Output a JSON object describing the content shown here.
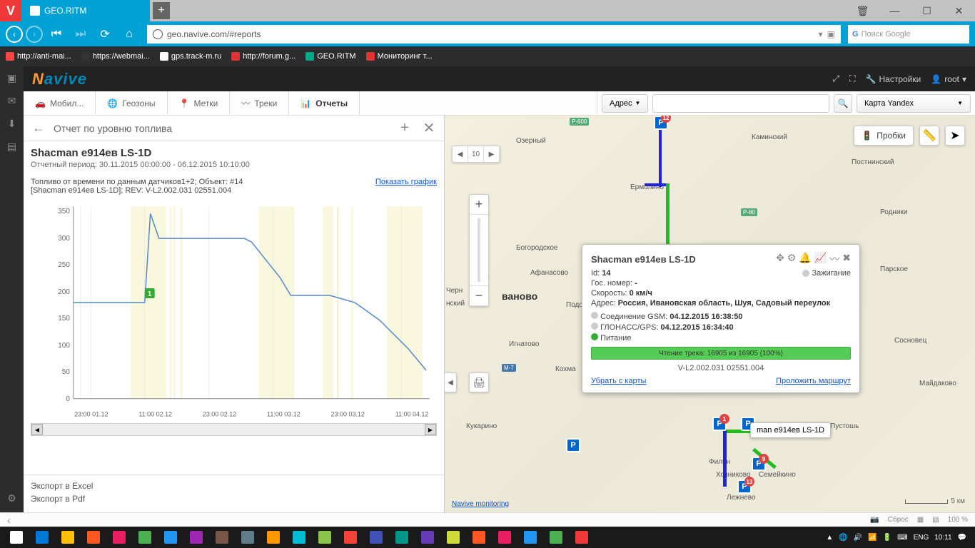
{
  "browser": {
    "tab_title": "GEO.RITM",
    "url": "geo.navive.com/#reports",
    "search_placeholder": "Поиск Google",
    "bookmarks": [
      "http://anti-mai...",
      "https://webmai...",
      "gps.track-m.ru",
      "http://forum.g...",
      "GEO.RITM",
      "Мониторинг т..."
    ]
  },
  "app": {
    "logo": "Navive",
    "settings": "Настройки",
    "user": "root",
    "tabs": {
      "mobile": "Мобил...",
      "geo": "Геозоны",
      "marks": "Метки",
      "tracks": "Треки",
      "reports": "Отчеты"
    },
    "addr_label": "Адрес",
    "map_type": "Карта Yandex"
  },
  "report": {
    "title": "Отчет по уровню топлива",
    "obj_name": "Shacman е914ев LS-1D",
    "period": "Отчетный период: 30.11.2015 00:00:00 - 06.12.2015 10:10:00",
    "chart_title1": "Топливо от времени по данным датчиков1+2; Объект: #14",
    "chart_title2": "[Shacman е914ев LS-1D]; REV: V-L2.002.031 02551.004",
    "show_chart": "Показать график",
    "export_excel": "Экспорт в Excel",
    "export_pdf": "Экспорт в Pdf"
  },
  "chart_data": {
    "type": "line",
    "title": "Топливо от времени по данным датчиков1+2; Объект: #14",
    "ylabel": "",
    "xlabel": "",
    "ylim": [
      0,
      360
    ],
    "y_ticks": [
      0,
      50,
      100,
      150,
      200,
      250,
      300,
      350
    ],
    "x_ticks": [
      "23:00 01.12",
      "11:00 02.12",
      "23:00 02.12",
      "11:00 03.12",
      "23:00 03.12",
      "11:00 04.12"
    ],
    "values": [
      {
        "x": 0,
        "y": 180
      },
      {
        "x": 120,
        "y": 180
      },
      {
        "x": 130,
        "y": 345
      },
      {
        "x": 145,
        "y": 295
      },
      {
        "x": 270,
        "y": 295
      },
      {
        "x": 280,
        "y": 290
      },
      {
        "x": 330,
        "y": 230
      },
      {
        "x": 345,
        "y": 200
      },
      {
        "x": 420,
        "y": 200
      },
      {
        "x": 450,
        "y": 190
      },
      {
        "x": 480,
        "y": 150
      },
      {
        "x": 510,
        "y": 100
      },
      {
        "x": 520,
        "y": 55
      }
    ],
    "marker": {
      "x": 132,
      "label": "1"
    }
  },
  "popup": {
    "title": "Shacman е914ев LS-1D",
    "ignition": "Зажигание",
    "id_label": "Id:",
    "id": "14",
    "reg_label": "Гос. номер:",
    "reg": "-",
    "speed_label": "Скорость:",
    "speed": "0 км/ч",
    "addr_label": "Адрес:",
    "addr": "Россия, Ивановская область, Шуя, Садовый переулок",
    "gsm_label": "Соединение GSM:",
    "gsm": "04.12.2015 16:38:50",
    "gps_label": "ГЛОНАСС/GPS:",
    "gps": "04.12.2015 16:34:40",
    "power": "Питание",
    "progress": "Чтение трека: 16905 из 16905 (100%)",
    "version": "V-L2.002.031 02551.004",
    "remove": "Убрать с карты",
    "route": "Проложить маршрут"
  },
  "obj_tooltip": "man е914ев LS-1D",
  "map": {
    "traffic": "Пробки",
    "scale": "5 км",
    "link": "Navive monitoring",
    "nav_center": "10",
    "cities": [
      "Озерный",
      "Каминский",
      "Постнинский",
      "Родники",
      "Парское",
      "Сосновец",
      "Майдаково",
      "Пустошь",
      "Ермолино",
      "Богородское",
      "Афанасово",
      "ваново",
      "Игнатово",
      "Кохма",
      "Черн",
      "нский",
      "Подоз",
      "Кукарино",
      "Хозниково",
      "Семейкино",
      "Филин",
      "Лежнево"
    ],
    "roads": [
      "Р-600",
      "Р-80",
      "М-7"
    ]
  },
  "status": {
    "reset": "Сброс",
    "zoom": "100 %"
  },
  "taskbar": {
    "lang": "ENG",
    "time": "10:11"
  }
}
